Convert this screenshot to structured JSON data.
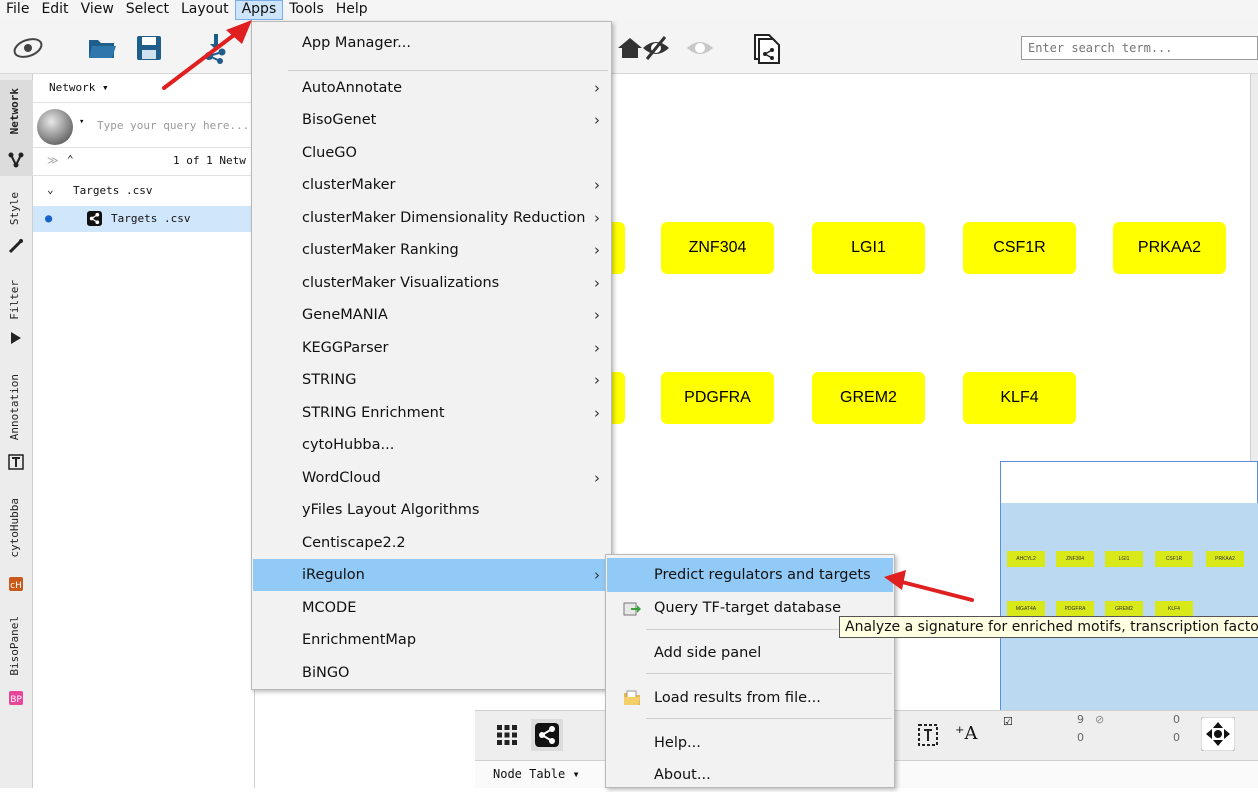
{
  "menubar": {
    "items": [
      "File",
      "Edit",
      "View",
      "Select",
      "Layout",
      "Apps",
      "Tools",
      "Help"
    ],
    "active": "Apps"
  },
  "toolbar": {
    "search_placeholder": "Enter search term..."
  },
  "left_tabs": [
    {
      "label": "Network",
      "icon": "network-icon"
    },
    {
      "label": "Style",
      "icon": "brush-icon"
    },
    {
      "label": "Filter",
      "icon": "filter-icon"
    },
    {
      "label": "Annotation",
      "icon": "annotation-icon"
    },
    {
      "label": "cytoHubba",
      "icon": "cytohubba-icon"
    },
    {
      "label": "BisoPanel",
      "icon": "bp-icon"
    }
  ],
  "network_panel": {
    "dropdown": "Network ▾",
    "query_placeholder": "Type your query here...",
    "count": "1 of 1 Netw",
    "tree": [
      {
        "label": "Targets .csv"
      },
      {
        "label": "Targets .csv"
      }
    ]
  },
  "canvas": {
    "nodes_row1": [
      "ZNF304",
      "LGI1",
      "CSF1R",
      "PRKAA2"
    ],
    "nodes_row2": [
      "PDGFRA",
      "GREM2",
      "KLF4"
    ],
    "node_color": "#ffff00"
  },
  "minimap": {
    "row1": [
      "AHCYL2",
      "ZNF304",
      "LGI1",
      "CSF1R",
      "PRKAA2"
    ],
    "row2": [
      "MGAT4A",
      "PDGFRA",
      "GREM2",
      "KLF4"
    ]
  },
  "apps_menu": {
    "items": [
      {
        "label": "App Manager...",
        "submenu": false
      },
      {
        "label": "AutoAnnotate",
        "submenu": true
      },
      {
        "label": "BisoGenet",
        "submenu": true
      },
      {
        "label": "ClueGO",
        "submenu": false
      },
      {
        "label": "clusterMaker",
        "submenu": true
      },
      {
        "label": "clusterMaker Dimensionality Reduction",
        "submenu": true
      },
      {
        "label": "clusterMaker Ranking",
        "submenu": true
      },
      {
        "label": "clusterMaker Visualizations",
        "submenu": true
      },
      {
        "label": "GeneMANIA",
        "submenu": true
      },
      {
        "label": "KEGGParser",
        "submenu": true
      },
      {
        "label": "STRING",
        "submenu": true
      },
      {
        "label": "STRING Enrichment",
        "submenu": true
      },
      {
        "label": "cytoHubba...",
        "submenu": false
      },
      {
        "label": "WordCloud",
        "submenu": true
      },
      {
        "label": "yFiles Layout Algorithms",
        "submenu": false
      },
      {
        "label": "Centiscape2.2",
        "submenu": false
      },
      {
        "label": "iRegulon",
        "submenu": true,
        "highlighted": true
      },
      {
        "label": "MCODE",
        "submenu": false
      },
      {
        "label": "EnrichmentMap",
        "submenu": false
      },
      {
        "label": "BiNGO",
        "submenu": false
      }
    ],
    "arrow_glyph": "›"
  },
  "iregulon_menu": {
    "items": [
      {
        "label": "Predict regulators and targets",
        "highlighted": true
      },
      {
        "label": "Query TF-target database"
      },
      {
        "label": "Add side panel"
      },
      {
        "label": "Load results from file..."
      },
      {
        "label": "Help..."
      },
      {
        "label": "About..."
      }
    ]
  },
  "tooltip": {
    "text": "Analyze a signature for enriched motifs, transcription factors and targets"
  },
  "bottom_bar": {
    "selected_nodes": "9",
    "total_nodes": "0",
    "selected_edges": "0",
    "total_edges": "0",
    "node_table_tab": "Node Table ▾"
  },
  "colors": {
    "highlight": "#91c9f7",
    "menu_bg": "#f2f2f2",
    "annotation_arrow": "#e02020",
    "tooltip_bg": "#ffffe1"
  }
}
